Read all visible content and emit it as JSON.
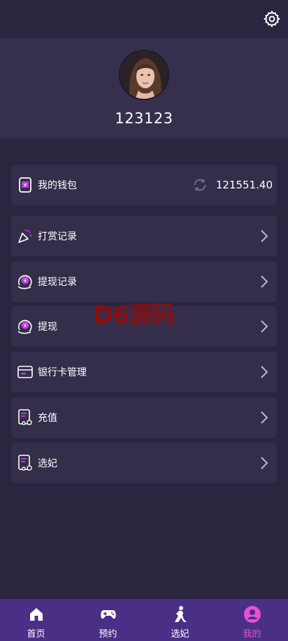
{
  "user": {
    "name": "123123"
  },
  "wallet": {
    "label": "我的钱包",
    "amount": "121551.40"
  },
  "menu": [
    {
      "label": "打赏记录"
    },
    {
      "label": "提现记录"
    },
    {
      "label": "提现"
    },
    {
      "label": "银行卡管理"
    },
    {
      "label": "充值"
    },
    {
      "label": "选妃"
    }
  ],
  "watermark": "D6源码",
  "tabs": [
    {
      "label": "首页"
    },
    {
      "label": "预约"
    },
    {
      "label": "选妃"
    },
    {
      "label": "我的"
    }
  ],
  "colors": {
    "accent": "#e84fd6",
    "background": "#2b2540",
    "card": "#342e4a",
    "tabbar": "#4a2f86"
  }
}
